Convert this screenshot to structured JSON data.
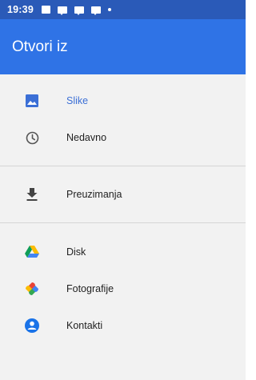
{
  "status_bar": {
    "time": "19:39",
    "icons": [
      "image-notification-icon",
      "message-notification-icon",
      "message-notification-icon",
      "message-notification-icon",
      "dot-notification-icon"
    ]
  },
  "app_bar": {
    "title": "Otvori iz"
  },
  "drawer": {
    "items": [
      {
        "label": "Slike",
        "icon": "image-icon",
        "active": true
      },
      {
        "label": "Nedavno",
        "icon": "clock-icon",
        "active": false
      },
      {
        "label": "Preuzimanja",
        "icon": "download-icon",
        "active": false
      },
      {
        "label": "Disk",
        "icon": "google-drive-icon",
        "active": false
      },
      {
        "label": "Fotografije",
        "icon": "google-photos-icon",
        "active": false
      },
      {
        "label": "Kontakti",
        "icon": "contacts-icon",
        "active": false
      }
    ]
  },
  "colors": {
    "status_bar": "#2a5ab8",
    "app_bar": "#2f73e6",
    "active_item": "#3b6fd6",
    "background": "#f2f2f2"
  }
}
